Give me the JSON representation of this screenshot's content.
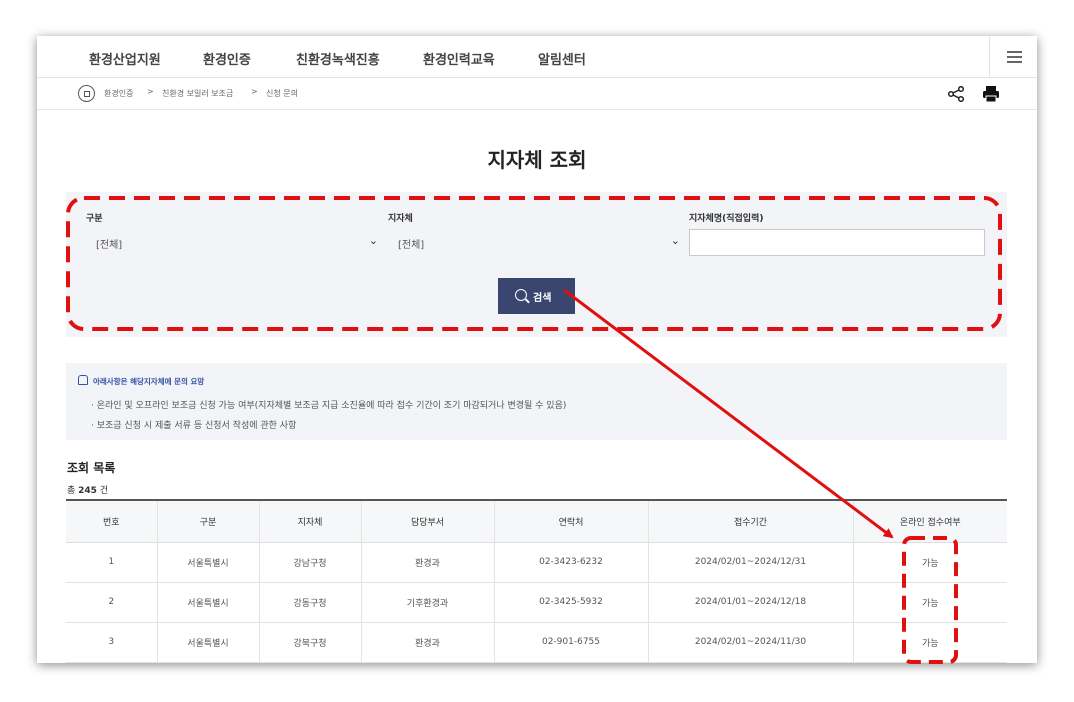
{
  "nav": {
    "items": [
      "환경산업지원",
      "환경인증",
      "친환경녹색진흥",
      "환경인력교육",
      "알림센터"
    ],
    "menu_icon": "hamburger-icon"
  },
  "breadcrumb": [
    "환경인증",
    "친환경 보일러 보조금",
    "신청 문의"
  ],
  "breadcrumb_separator": ">",
  "page": {
    "title": "지자체 조회"
  },
  "search": {
    "category_label": "구분",
    "category_value": "[전체]",
    "region_label": "지자체",
    "region_value": "[전체]",
    "name_label": "지자체명(직접입력)",
    "name_value": "",
    "button_label": "검색"
  },
  "notice": {
    "title": "아래사항은 해당지자체에 문의 요망",
    "lines": [
      "· 온라인 및 오프라인 보조금 신청 가능 여부(지자체별 보조금 지급 소진율에 따라 접수 기간이 조기 마감되거나 변경될 수 있음)",
      "· 보조금 신청 시 제출 서류 등 신청서 작성에 관한 사항"
    ]
  },
  "list": {
    "title": "조회 목록",
    "total_prefix": "총",
    "total_count": "245",
    "total_suffix": "건",
    "columns": [
      "번호",
      "구분",
      "지자체",
      "담당부서",
      "연락처",
      "접수기간",
      "온라인 접수여부"
    ],
    "rows": [
      [
        "1",
        "서울특별시",
        "강남구청",
        "환경과",
        "02-3423-6232",
        "2024/02/01~2024/12/31",
        "가능"
      ],
      [
        "2",
        "서울특별시",
        "강동구청",
        "기후환경과",
        "02-3425-5932",
        "2024/01/01~2024/12/18",
        "가능"
      ],
      [
        "3",
        "서울특별시",
        "강북구청",
        "환경과",
        "02-901-6755",
        "2024/02/01~2024/11/30",
        "가능"
      ]
    ]
  },
  "annotation_color": "#e01010",
  "brand_button_color": "#3a4570"
}
